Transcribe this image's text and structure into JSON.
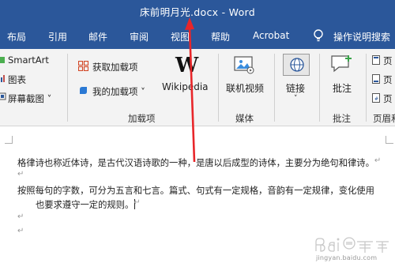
{
  "window": {
    "title": "床前明月光.docx  -  Word"
  },
  "tabs": [
    "布局",
    "引用",
    "邮件",
    "审阅",
    "视图",
    "帮助",
    "Acrobat"
  ],
  "tell_me": "操作说明搜索",
  "ribbon": {
    "illustrations": {
      "smartart": "SmartArt",
      "chart": "图表",
      "screenshot": "屏幕截图"
    },
    "addins": {
      "get_addins": "获取加载项",
      "my_addins": "我的加载项",
      "wikipedia": "Wikipedia",
      "group": "加载项"
    },
    "media": {
      "online_video": "联机视频",
      "group": "媒体"
    },
    "links": {
      "link": "链接"
    },
    "comments": {
      "comment": "批注",
      "group": "批注"
    },
    "header_footer": {
      "group": "页眉和",
      "items": [
        "页",
        "页",
        "页"
      ]
    }
  },
  "document": {
    "lines": [
      "格律诗也称近体诗，是古代汉语诗歌的一种，是唐以后成型的诗体，主要分为绝句和律诗。",
      "按照每句的字数，可分为五言和七言。篇式、句式有一定规格，音韵有一定规律，变化使用",
      "也要求遵守一定的规则。"
    ]
  },
  "watermark": {
    "brand": "Bai经验",
    "url": "jingyan.baidu.com"
  }
}
